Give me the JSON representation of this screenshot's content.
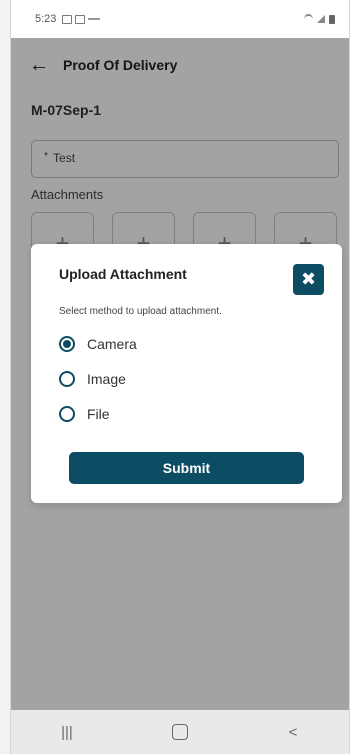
{
  "status_bar": {
    "time": "5:23"
  },
  "header": {
    "back_icon": "arrow-left-icon",
    "title": "Proof Of Delivery"
  },
  "order": {
    "number": "M-07Sep-1"
  },
  "field": {
    "required_mark": "*",
    "value": "Test"
  },
  "attachments": {
    "label": "Attachments",
    "add_icon": "plus-icon",
    "tile_count": 4
  },
  "modal": {
    "title": "Upload Attachment",
    "close_icon": "close-icon",
    "description": "Select method to upload attachment.",
    "options": [
      {
        "label": "Camera",
        "selected": true
      },
      {
        "label": "Image",
        "selected": false
      },
      {
        "label": "File",
        "selected": false
      }
    ],
    "submit_label": "Submit"
  },
  "colors": {
    "accent": "#0d4d64"
  },
  "nav": {
    "recents_icon": "recents-icon",
    "home_icon": "home-icon",
    "back_icon": "chevron-left-icon"
  }
}
